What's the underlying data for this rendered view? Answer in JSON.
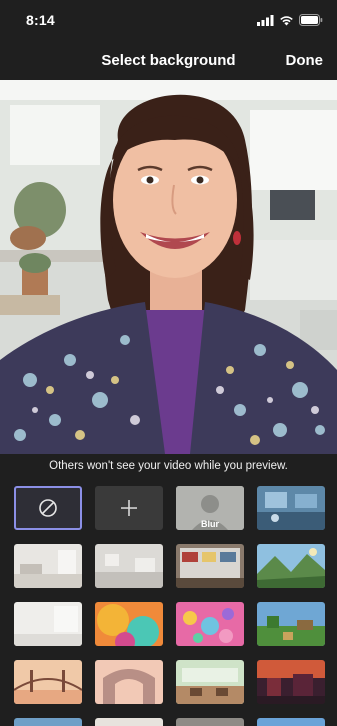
{
  "status": {
    "time": "8:14"
  },
  "header": {
    "title": "Select background",
    "done_label": "Done"
  },
  "notice": "Others won't see your video while you preview.",
  "backgrounds": {
    "none_icon": "no-background-icon",
    "add_icon": "plus-icon",
    "blur_label": "Blur"
  },
  "colors": {
    "selected_border": "#8b8fe6",
    "panel_bg": "#1f1f1f"
  }
}
